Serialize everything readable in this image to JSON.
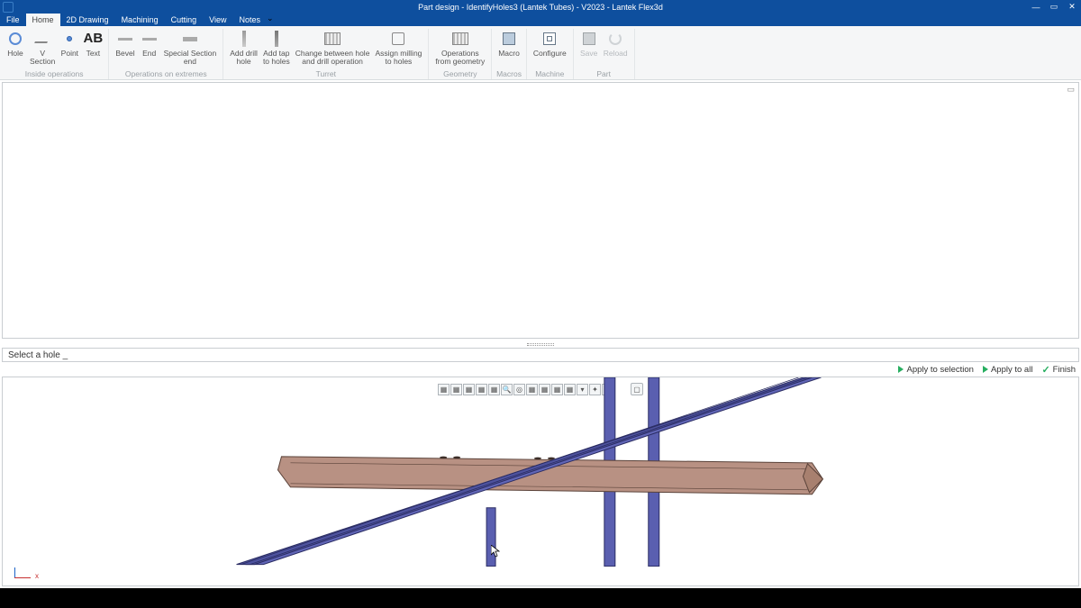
{
  "titlebar": {
    "title": "Part design - IdentifyHoles3 (Lantek Tubes) - V2023 - Lantek Flex3d",
    "min": "—",
    "max": "▭",
    "close": "✕"
  },
  "menu": {
    "file": "File",
    "home": "Home",
    "drawing2d": "2D Drawing",
    "machining": "Machining",
    "cutting": "Cutting",
    "view": "View",
    "notes": "Notes"
  },
  "ribbon": {
    "groups": {
      "inside": {
        "label": "Inside operations",
        "hole": "Hole",
        "vsection": "V\nSection",
        "point": "Point",
        "text": "Text"
      },
      "extremes": {
        "label": "Operations on extremes",
        "bevel": "Bevel",
        "end": "End",
        "special": "Special Section\nend"
      },
      "turret": {
        "label": "Turret",
        "adddrill": "Add drill\nhole",
        "addtap": "Add tap\nto holes",
        "change": "Change between hole\nand drill operation",
        "assign": "Assign milling\nto holes"
      },
      "geometry": {
        "label": "Geometry",
        "opgeom": "Operations\nfrom geometry"
      },
      "macros": {
        "label": "Macros",
        "macro": "Macro"
      },
      "machine": {
        "label": "Machine",
        "configure": "Configure"
      },
      "part": {
        "label": "Part",
        "save": "Save",
        "reload": "Reload"
      }
    }
  },
  "command_prompt": "Select a hole _",
  "actions": {
    "apply_sel": "Apply to selection",
    "apply_all": "Apply to all",
    "finish": "Finish"
  },
  "viewport_toolbar": {
    "items": [
      "iso-icon",
      "front-icon",
      "back-icon",
      "left-icon",
      "right-icon",
      "zoom-icon",
      "fit-icon",
      "shade-icon",
      "wire-icon",
      "hidden-icon",
      "edges-icon",
      "drop1-icon",
      "tools-icon",
      "drop2-icon"
    ],
    "standalone": "snapshot-icon"
  },
  "origin": {
    "x": "x",
    "z": ""
  },
  "colors": {
    "titlebar": "#0e4f9e",
    "tube_purple": "#5a5fb0",
    "beam_brown": "#b89183",
    "accent_green": "#27ae60"
  }
}
